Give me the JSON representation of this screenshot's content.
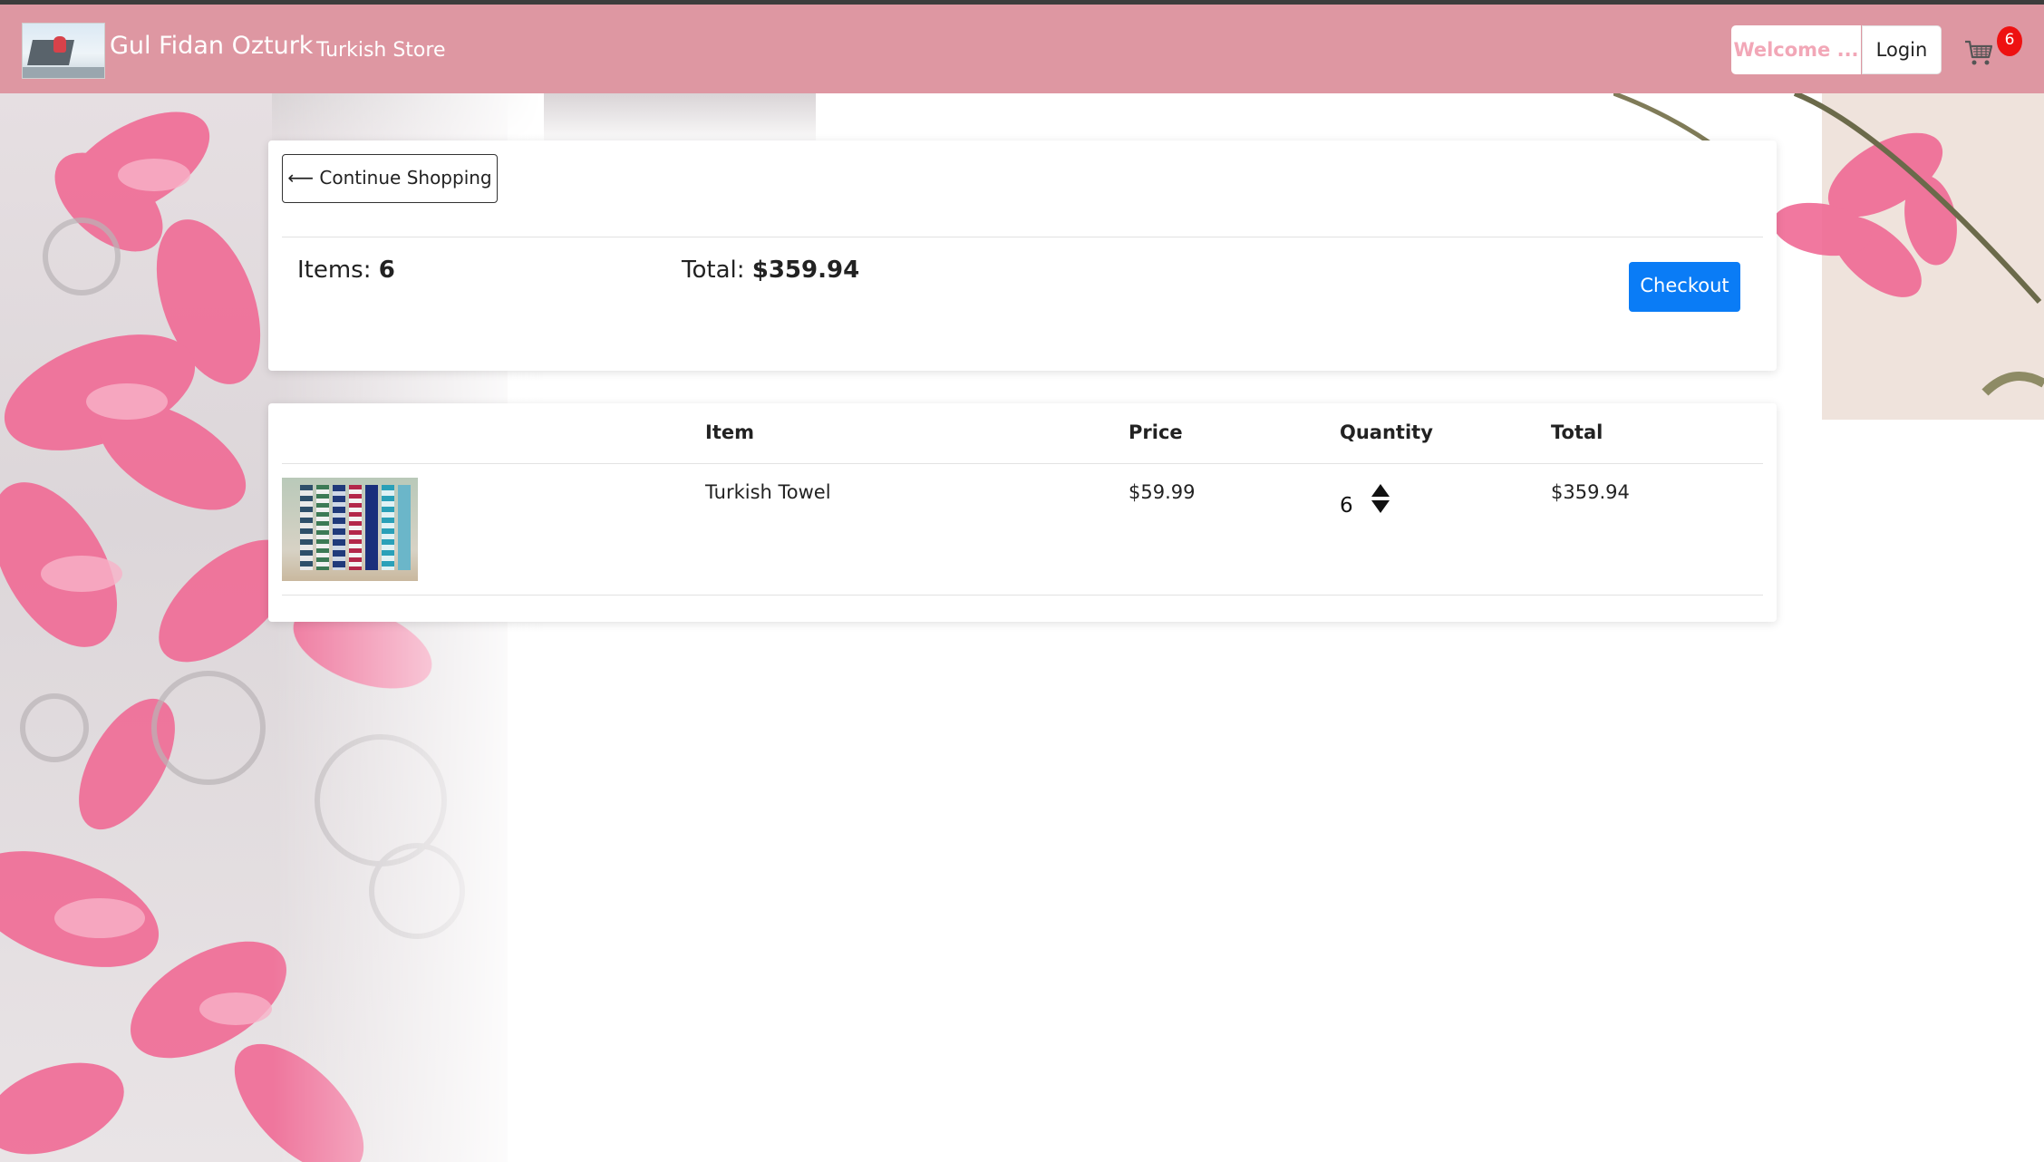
{
  "navbar": {
    "brand_name": "Gul Fidan Ozturk",
    "store_link": "Turkish Store",
    "welcome_text": "Welcome ...",
    "login_label": "Login",
    "cart_count": "6",
    "cart_icon": "shopping-cart-icon"
  },
  "summary": {
    "continue_label": "⟵ Continue Shopping",
    "items_prefix": "Items: ",
    "items_count": "6",
    "total_prefix": "Total: ",
    "total_value": "$359.94",
    "checkout_label": "Checkout"
  },
  "table": {
    "headers": {
      "item": "Item",
      "price": "Price",
      "quantity": "Quantity",
      "total": "Total"
    },
    "rows": [
      {
        "name": "Turkish Towel",
        "price": "$59.99",
        "quantity": "6",
        "total": "$359.94"
      }
    ]
  },
  "colors": {
    "navbar": "#de97a2",
    "checkout": "#0a7cf6",
    "badge": "#ee1111"
  }
}
